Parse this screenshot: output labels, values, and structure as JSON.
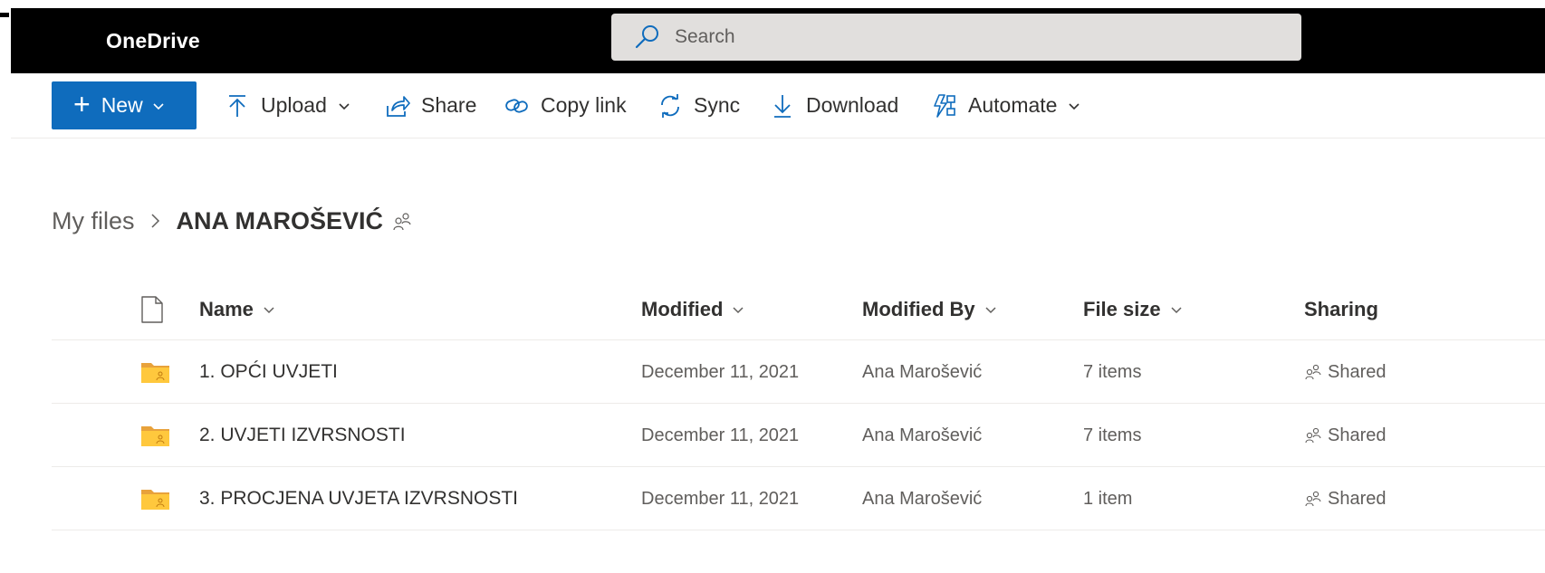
{
  "header": {
    "brand": "OneDrive",
    "search_placeholder": "Search"
  },
  "command_bar": {
    "new_label": "New",
    "upload_label": "Upload",
    "share_label": "Share",
    "copy_link_label": "Copy link",
    "sync_label": "Sync",
    "download_label": "Download",
    "automate_label": "Automate"
  },
  "breadcrumb": {
    "root": "My files",
    "current": "ANA MAROŠEVIĆ"
  },
  "list": {
    "columns": {
      "name": "Name",
      "modified": "Modified",
      "modified_by": "Modified By",
      "file_size": "File size",
      "sharing": "Sharing"
    },
    "rows": [
      {
        "name": "1. OPĆI UVJETI",
        "modified": "December 11, 2021",
        "modified_by": "Ana Marošević",
        "size": "7 items",
        "sharing": "Shared"
      },
      {
        "name": "2. UVJETI IZVRSNOSTI",
        "modified": "December 11, 2021",
        "modified_by": "Ana Marošević",
        "size": "7 items",
        "sharing": "Shared"
      },
      {
        "name": "3. PROCJENA UVJETA IZVRSNOSTI",
        "modified": "December 11, 2021",
        "modified_by": "Ana Marošević",
        "size": "1 item",
        "sharing": "Shared"
      }
    ]
  },
  "colors": {
    "header_bg": "#000000",
    "accent": "#0f6cbd",
    "search_bg": "#e1dfdd",
    "folder": "#ffc83d",
    "folder_back": "#e8a23b"
  },
  "icons": [
    "search-icon",
    "plus-icon",
    "chevron-down-icon",
    "upload-icon",
    "share-icon",
    "link-icon",
    "sync-icon",
    "download-icon",
    "automate-icon",
    "chevron-right-icon",
    "people-icon",
    "document-icon",
    "shared-folder-icon"
  ]
}
